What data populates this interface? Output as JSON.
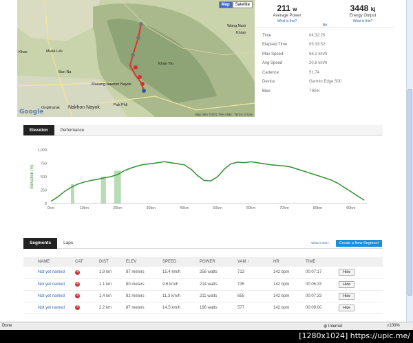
{
  "map": {
    "tabs": [
      "Map",
      "Satellite"
    ],
    "labels": [
      "Wang Nam",
      "Khiao",
      "Khae",
      "Muak Lek",
      "Ban Na",
      "Mueang Nakhon Nayok",
      "Nakhon Nayok",
      "Ongkharak",
      "Pak Phli",
      "Khao Yai",
      "Google"
    ],
    "footer": "Map data ©2011 Tele Atlas · Terms of Use"
  },
  "summary": {
    "power_value": "211",
    "power_unit": "w",
    "power_label": "Average Power",
    "power_link": "What is this?",
    "bit_link": "Bit",
    "energy_value": "3448",
    "energy_unit": "kj",
    "energy_label": "Energy Output",
    "energy_link": "What is this?"
  },
  "info": [
    {
      "key": "Time",
      "value": "04:32:25"
    },
    {
      "key": "Elapsed Time",
      "value": "05:33:52"
    },
    {
      "key": "Max Speed",
      "value": "66.2 km/h"
    },
    {
      "key": "Avg Speed",
      "value": "20.8 km/h"
    },
    {
      "key": "Cadence",
      "value": "51.74"
    },
    {
      "key": "Device",
      "value": "Garmin Edge 500"
    },
    {
      "key": "Bike",
      "value": "TREK"
    }
  ],
  "elevation_tabs": [
    "Elevation",
    "Performance"
  ],
  "chart_data": {
    "type": "area",
    "ylabel": "Elevation (m)",
    "yticks": [
      "1,000",
      "750",
      "500",
      "250",
      "0"
    ],
    "xticks": [
      "0km",
      "10km",
      "20km",
      "30km",
      "40km",
      "50km",
      "60km",
      "70km",
      "80km",
      "90km"
    ],
    "ylim": [
      0,
      1000
    ],
    "xlim": [
      0,
      95
    ],
    "x": [
      0,
      2,
      4,
      6,
      8,
      10,
      12,
      14,
      16,
      18,
      20,
      22,
      24,
      26,
      28,
      30,
      32,
      34,
      36,
      38,
      40,
      42,
      44,
      46,
      48,
      50,
      52,
      54,
      56,
      58,
      60,
      62,
      64,
      66,
      68,
      70,
      72,
      74,
      76,
      78,
      80,
      82,
      84,
      86,
      88,
      90,
      92,
      94
    ],
    "y": [
      40,
      120,
      220,
      300,
      360,
      400,
      430,
      450,
      480,
      500,
      540,
      610,
      660,
      700,
      730,
      740,
      760,
      780,
      760,
      740,
      720,
      640,
      520,
      430,
      420,
      500,
      640,
      740,
      770,
      760,
      780,
      760,
      740,
      720,
      710,
      700,
      680,
      640,
      600,
      560,
      520,
      480,
      440,
      380,
      300,
      220,
      140,
      60
    ],
    "highlights": [
      [
        6,
        7
      ],
      [
        15,
        16.5
      ],
      [
        19,
        21
      ]
    ],
    "grid": false,
    "legend": "none"
  },
  "segments": {
    "tabs": [
      "Segments",
      "Laps"
    ],
    "what_is_this": "What is this?",
    "create_button": "Create a New Segment",
    "headers": [
      "NAME",
      "CAT",
      "DIST",
      "ELEV",
      "SPEED",
      "POWER",
      "VAM",
      "HR",
      "TIME",
      ""
    ],
    "sort_indicator": "↑",
    "cat_icon_text": "4",
    "rows": [
      {
        "name": "Not yet named",
        "dist": "1.9 km",
        "elev": "87 meters",
        "speed": "15.4 km/h",
        "power": "256 watts",
        "vam": "713",
        "hr": "142 bpm",
        "time": "00:07:17",
        "action": "Hide"
      },
      {
        "name": "Not yet named",
        "dist": "1.1 km",
        "elev": "80 meters",
        "speed": "9.6 km/h",
        "power": "214 watts",
        "vam": "735",
        "hr": "142 bpm",
        "time": "00:06:33",
        "action": "Hide"
      },
      {
        "name": "Not yet named",
        "dist": "1.4 km",
        "elev": "82 meters",
        "speed": "11.3 km/h",
        "power": "211 watts",
        "vam": "655",
        "hr": "142 bpm",
        "time": "00:07:33",
        "action": "Hide"
      },
      {
        "name": "Not yet named",
        "dist": "2.2 km",
        "elev": "87 meters",
        "speed": "14.5 km/h",
        "power": "196 watts",
        "vam": "577",
        "hr": "142 bpm",
        "time": "00:09:00",
        "action": "Hide"
      }
    ]
  },
  "statusbar": {
    "left": "Done",
    "internet": "Internet",
    "zoom": "100%"
  },
  "watermark": "[1280x1024] https://upic.me/"
}
